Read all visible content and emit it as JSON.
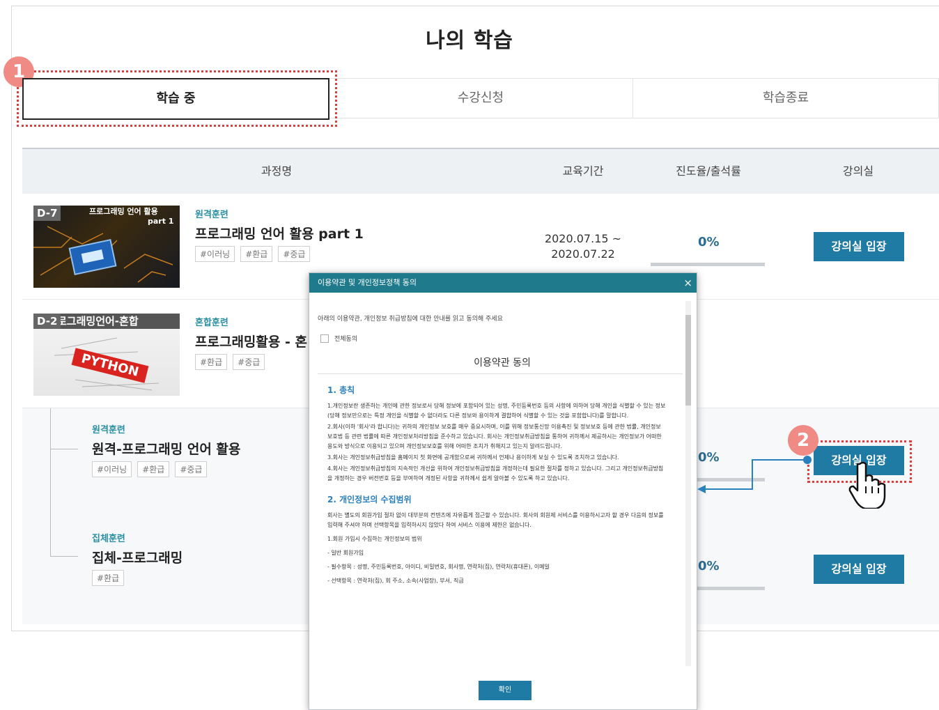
{
  "page": {
    "title": "나의 학습"
  },
  "tabs": [
    {
      "label": "학습 중",
      "active": true
    },
    {
      "label": "수강신청",
      "active": false
    },
    {
      "label": "학습종료",
      "active": false
    }
  ],
  "callouts": {
    "one": "1",
    "two": "2"
  },
  "table": {
    "headers": [
      "과정명",
      "교육기간",
      "진도율/출석률",
      "강의실"
    ]
  },
  "courses": [
    {
      "dday": "D-7",
      "thumb_text_1": "프로그래밍 언어 활용",
      "thumb_text_2": "part 1",
      "category": "원격훈련",
      "title": "프로그래밍 언어 활용 part 1",
      "tags": [
        "#이러닝",
        "#환급",
        "#중급"
      ],
      "period_start": "2020.07.15 ~",
      "period_end": "2020.07.22",
      "progress_label": "0%",
      "progress": 0,
      "button": "강의실 입장"
    },
    {
      "dday": "D-2",
      "thumb_text_1": "로그래밍언어-혼합",
      "thumb_text_2": "PYTHON",
      "category": "혼합훈련",
      "title": "프로그래밍활용 - 혼",
      "tags": [
        "#환급",
        "#중급"
      ]
    }
  ],
  "sub_courses": [
    {
      "category": "원격훈련",
      "title": "원격-프로그래밍 언어 활용",
      "tags": [
        "#이러닝",
        "#환급",
        "#중급"
      ],
      "progress_label": "0%",
      "progress": 0,
      "button": "강의실 입장"
    },
    {
      "category": "집체훈련",
      "title": "집체-프로그래밍",
      "tags": [
        "#환급"
      ],
      "progress_label": "0%",
      "progress": 0,
      "button": "강의실 입장"
    }
  ],
  "modal": {
    "title": "이용약관 및 개인정보정책 동의",
    "close": "×",
    "instruction": "아래의 이용약관, 개인정보 취급방침에 대한 안내를 읽고 동의해 주세요",
    "agree_all": "전체동의",
    "heading": "이용약관 동의",
    "section1_title": "1. 총칙",
    "section1_paras": [
      "1.개인정보란 생존하는 개인에 관한 정보로서 당해 정보에 포함되어 있는 성명, 주민등록번호 등의 사항에 의하여 당해 개인을 식별할 수 있는 정보(당해 정보만으로는 특정 개인을 식별할 수 없더라도 다른 정보와 용이하게 결합하여 식별할 수 있는 것을 포함합니다)를 말합니다.",
      "2.회사(이하 '회사'라 합니다)는 귀하의 개인정보 보호를 매우 중요시하며, 이를 위해 정보통신망 이용촉진 및 정보보호 등에 관한 법률, 개인정보보호법 등 관련 법률에 따른 개인정보처리방침을 준수하고 있습니다. 회사는 개인정보취급방침을 통하여 귀하께서 제공하시는 개인정보가 어떠한 용도와 방식으로 이용되고 있으며 개인정보보호를 위해 어떠한 조치가 취해지고 있는지 알려드립니다.",
      "3.회사는 개인정보취급방침을 홈페이지 첫 화면에 공개함으로써 귀하께서 언제나 용이하게 보실 수 있도록 조치하고 있습니다.",
      "4.회사는 개인정보취급방침의 지속적인 개선을 위하여 개인정보취급방침을 개정하는데 필요한 절차를 정하고 있습니다. 그리고 개인정보취급방침을 개정하는 경우 버전번호 등을 부여하여 개정된 사항을 귀하께서 쉽게 알아볼 수 있도록 하고 있습니다."
    ],
    "section2_title": "2. 개인정보의 수집범위",
    "section2_paras": [
      "회사는 별도의 회원가입 절차 없이 대부분의 컨텐츠에 자유롭게 접근할 수 있습니다. 회사의 회원제 서비스를 이용하시고자 할 경우 다음의 정보를 입력해 주셔야 하며 선택항목을 입력하시지 않았다 하여 서비스 이용에 제한은 없습니다.",
      "1.회원 가입시 수집하는 개인정보의 범위",
      "- 일반 회원가입",
      "- 필수항목 : 성명, 주민등록번호, 아이디, 비밀번호, 회사명, 연락처(집), 연락처(휴대폰), 이메일",
      "- 선택항목 : 연락처(집), 회 주소, 소속(사업장), 부서, 직급"
    ],
    "confirm": "확인"
  },
  "colors": {
    "accent": "#1f7aa4",
    "modal_header": "#1f7a8c",
    "callout": "#e23c3c",
    "badge": "#f08a84",
    "category": "#2a8fa3",
    "connector": "#2a7fbd"
  }
}
